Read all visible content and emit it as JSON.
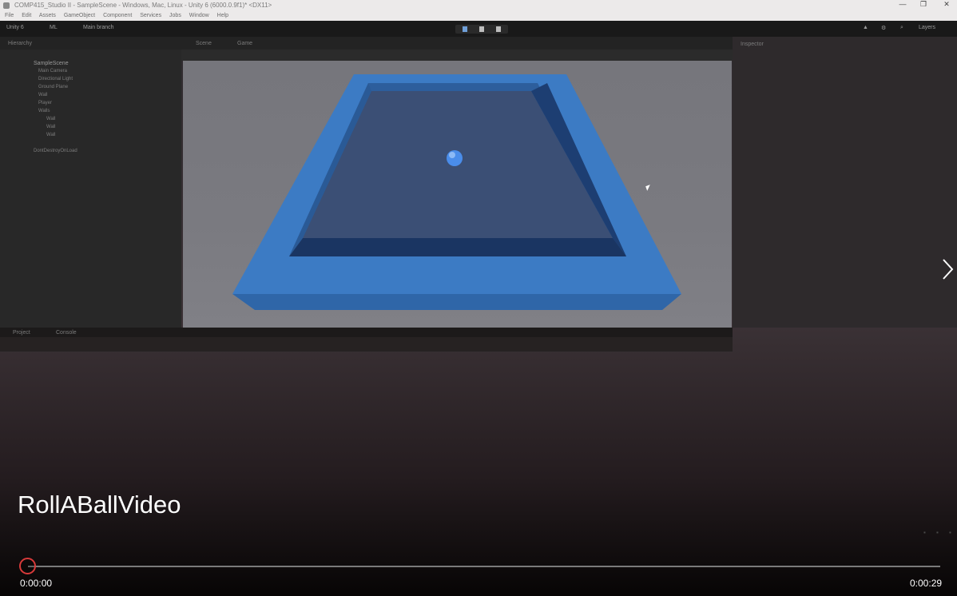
{
  "window": {
    "title": "COMP415_Studio II - SampleScene - Windows, Mac, Linux - Unity 6 (6000.0.9f1)* <DX11>",
    "controls": [
      "—",
      "❐",
      "✕"
    ]
  },
  "menu": [
    "File",
    "Edit",
    "Assets",
    "GameObject",
    "Component",
    "Services",
    "Jobs",
    "Window",
    "Help"
  ],
  "toolbar": {
    "account": "Unity 6",
    "layers": "ML",
    "cloud": "Main branch",
    "right": [
      "▲",
      "⚙",
      "⌕",
      "Layers"
    ]
  },
  "tabs": {
    "hierarchy": "Hierarchy",
    "scene": "Scene",
    "game": "Game",
    "inspector": "Inspector",
    "project": "Project",
    "console": "Console"
  },
  "hierarchy": {
    "scene_name": "SampleScene",
    "objects": [
      "Main Camera",
      "Directional Light",
      "Ground Plane",
      "Wall",
      "Player",
      "Walls",
      "Wall",
      "Wall",
      "Wall"
    ],
    "dontdestroy": "DontDestroyOnLoad"
  },
  "player": {
    "title": "RollABallVideo",
    "current_time": "0:00:00",
    "duration": "0:00:29",
    "progress": 0.0,
    "next_icon": "chevron-right-icon"
  },
  "colors": {
    "accent": "#d83a3a",
    "arena_light": "#3c7bc4",
    "arena_dark": "#1d3e72",
    "ball": "#4a8dea"
  }
}
